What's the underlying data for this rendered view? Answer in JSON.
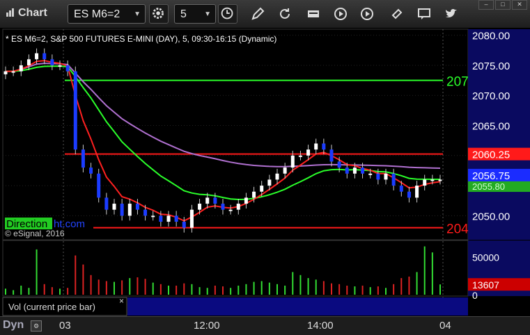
{
  "app": {
    "title": "Chart"
  },
  "toolbar": {
    "symbol": "ES M6=2",
    "interval": "5",
    "icons": [
      "gear-icon",
      "clock-icon",
      "pencil-icon",
      "refresh-icon",
      "get-icon",
      "play-icon",
      "link-icon",
      "chat-icon",
      "twitter-icon"
    ]
  },
  "window": {
    "restore": "–",
    "maximize": "□",
    "close": "✕"
  },
  "chart": {
    "header": "* ES M6=2, S&P 500 FUTURES E-MINI (DAY), 5, 09:30-16:15 (Dynamic)",
    "copyright": "© eSignal, 2016",
    "watermark_tag": "Direction",
    "watermark_rest": "ht.com",
    "price_ticks": [
      "2080.00",
      "2075.00",
      "2070.00",
      "2065.00",
      "2060.00",
      "2055.00",
      "2050.00"
    ],
    "price_range": [
      2046.0,
      2081.0
    ],
    "last_price": "2056.75",
    "resistance": {
      "label": "2060.25",
      "value": 2060.25
    },
    "green_level_label": "207",
    "green_level_value": 2072.5,
    "red_low_label": "204",
    "red_low_value": 2048.0,
    "hidden_green_label": "2055.80",
    "x_labels": [
      "03",
      "12:00",
      "14:00",
      "04"
    ],
    "volume": {
      "panel_title": "Vol (current price bar)",
      "close_glyph": "×",
      "ticks": [
        "50000",
        "0"
      ],
      "range": [
        0,
        70000
      ],
      "last_label": "13607"
    }
  },
  "status": {
    "mode": "Dyn"
  },
  "colors": {
    "up": "#ffffff",
    "down": "#1b3cff",
    "resistance": "#ff1a1a",
    "ema_fast": "#ff2020",
    "ema_slow": "#22ff22",
    "vwap": "#b070d0",
    "axis_bg": "#0a0a60",
    "green_level": "#2aff2a"
  },
  "chart_data": {
    "type": "candlestick",
    "bars_approx_close": [
      2074,
      2074,
      2075,
      2076,
      2077,
      2076,
      2075,
      2075,
      2074,
      2061,
      2058,
      2057,
      2053,
      2051,
      2052,
      2050,
      2052,
      2051,
      2050,
      2050,
      2049,
      2050,
      2049,
      2048,
      2051,
      2052,
      2053,
      2052,
      2051,
      2051,
      2052,
      2053,
      2054,
      2055,
      2056,
      2057,
      2058,
      2060,
      2060,
      2061,
      2062,
      2061,
      2059,
      2058,
      2057,
      2058,
      2057,
      2057,
      2056,
      2057,
      2055,
      2054,
      2053,
      2055,
      2056,
      2056,
      2056
    ],
    "volume_approx": [
      8000,
      6000,
      12000,
      9000,
      60000,
      14000,
      10000,
      8000,
      9000,
      52000,
      40000,
      26000,
      20000,
      18000,
      17000,
      19000,
      22000,
      23000,
      21000,
      16000,
      14000,
      12000,
      12000,
      15000,
      14000,
      10000,
      9000,
      12000,
      11000,
      9000,
      12000,
      14000,
      17000,
      18000,
      16000,
      14000,
      12000,
      30000,
      26000,
      22000,
      20000,
      18000,
      15000,
      14000,
      12000,
      11000,
      12000,
      10000,
      11000,
      9000,
      14000,
      22000,
      24000,
      30000,
      64000,
      56000,
      13607
    ]
  }
}
